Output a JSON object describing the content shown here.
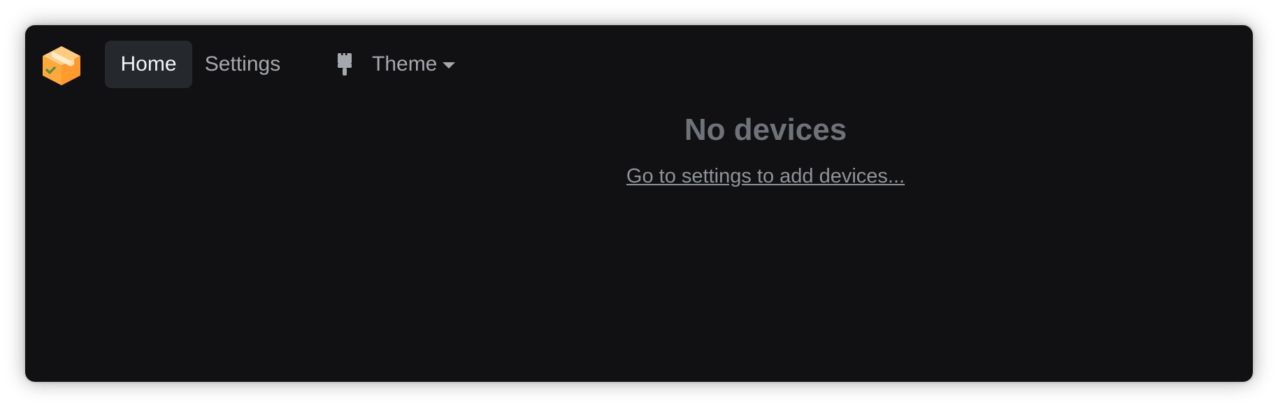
{
  "app": {
    "logo_icon": "package-box-icon",
    "accent_color": "#ffb14a"
  },
  "nav": {
    "items": [
      {
        "label": "Home",
        "active": true
      },
      {
        "label": "Settings",
        "active": false
      }
    ],
    "theme": {
      "label": "Theme",
      "icon": "paint-brush-icon",
      "caret_icon": "caret-down-icon"
    }
  },
  "main": {
    "empty_title": "No devices",
    "empty_link": "Go to settings to add devices..."
  },
  "colors": {
    "background": "#111113",
    "active_tab": "#25282d",
    "muted_text": "#6f7379"
  }
}
